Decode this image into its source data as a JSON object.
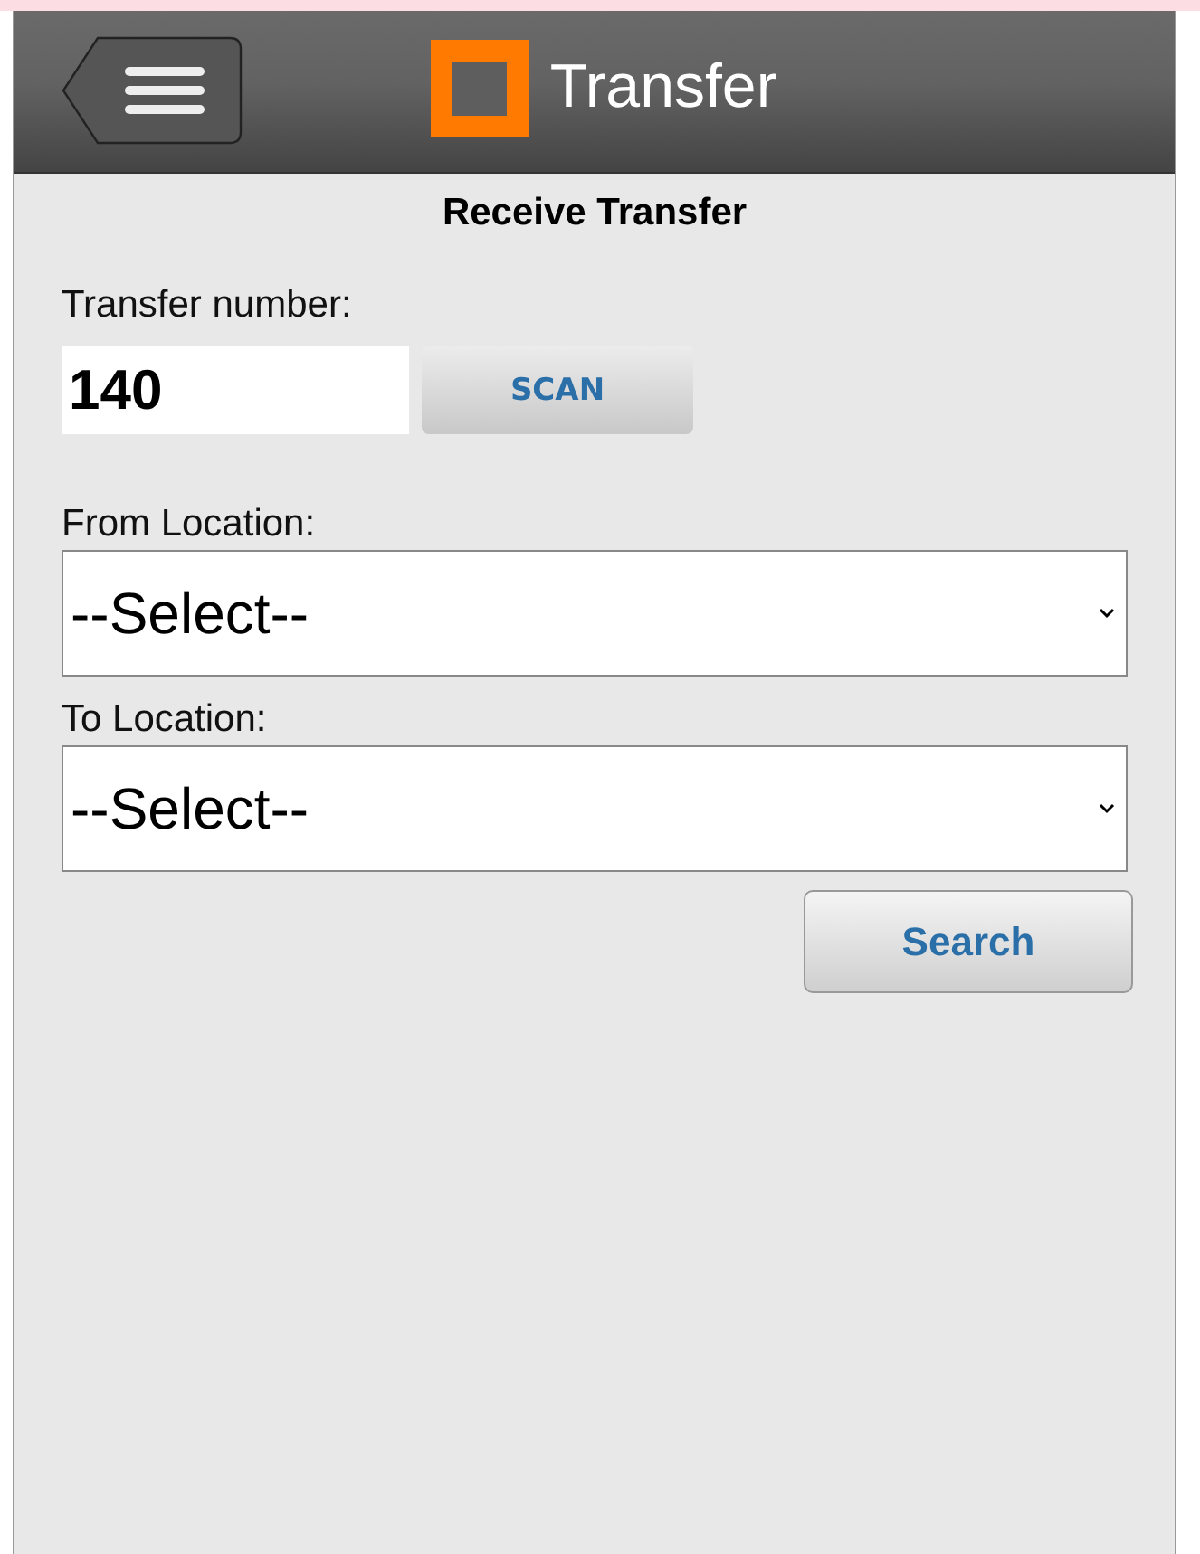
{
  "header": {
    "title": "Transfer"
  },
  "page_title": "Receive Transfer",
  "transfer_number": {
    "label": "Transfer number:",
    "value": "140",
    "scan_button": "SCAN"
  },
  "locations": [
    {
      "label": "From Location:",
      "value": "--Select--"
    },
    {
      "label": "To Location:",
      "value": "--Select--"
    }
  ],
  "search_button": "Search"
}
